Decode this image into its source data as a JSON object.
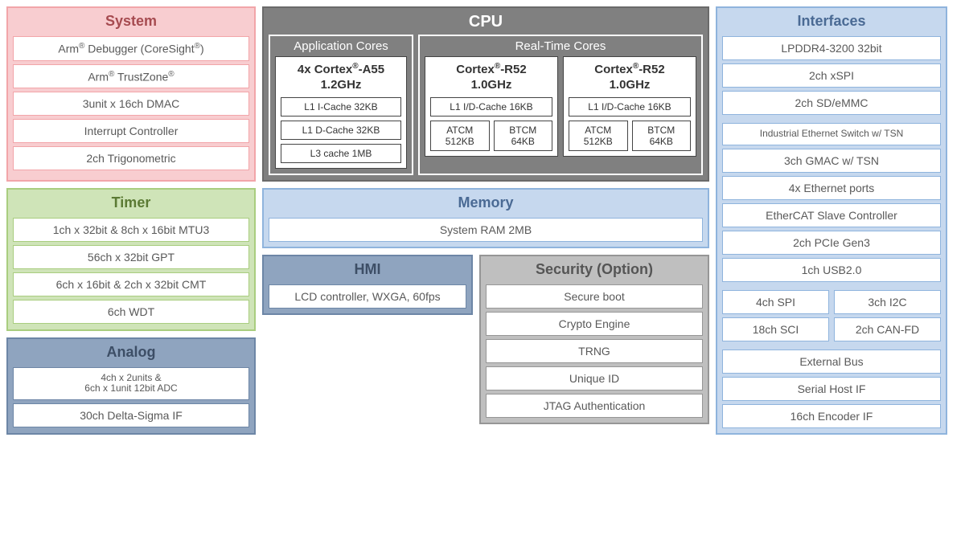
{
  "system": {
    "title": "System",
    "items": [
      "Arm® Debugger (CoreSight®)",
      "Arm® TrustZone®",
      "3unit x 16ch DMAC",
      "Interrupt Controller",
      "2ch Trigonometric"
    ]
  },
  "timer": {
    "title": "Timer",
    "items": [
      "1ch x 32bit & 8ch x 16bit MTU3",
      "56ch x 32bit GPT",
      "6ch x 16bit & 2ch x 32bit CMT",
      "6ch WDT"
    ]
  },
  "analog": {
    "title": "Analog",
    "adc_line1": "4ch x 2units &",
    "adc_line2": "6ch x 1unit 12bit ADC",
    "items": [
      "30ch Delta-Sigma IF"
    ]
  },
  "cpu": {
    "title": "CPU",
    "app_group": "Application Cores",
    "rt_group": "Real-Time Cores",
    "app_core": {
      "name": "4x Cortex®-A55",
      "freq": "1.2GHz",
      "l1i": "L1 I-Cache 32KB",
      "l1d": "L1 D-Cache 32KB",
      "l3": "L3 cache 1MB"
    },
    "rt_core": {
      "name": "Cortex®-R52",
      "freq": "1.0GHz",
      "l1": "L1 I/D-Cache 16KB",
      "atcm": "ATCM 512KB",
      "btcm": "BTCM 64KB"
    }
  },
  "memory": {
    "title": "Memory",
    "items": [
      "System RAM 2MB"
    ]
  },
  "hmi": {
    "title": "HMI",
    "items": [
      "LCD controller, WXGA, 60fps"
    ]
  },
  "security": {
    "title": "Security (Option)",
    "items": [
      "Secure boot",
      "Crypto Engine",
      "TRNG",
      "Unique ID",
      "JTAG Authentication"
    ]
  },
  "interfaces": {
    "title": "Interfaces",
    "top": [
      "LPDDR4-3200 32bit",
      "2ch xSPI",
      "2ch SD/eMMC"
    ],
    "net": [
      "Industrial Ethernet Switch w/ TSN",
      "3ch GMAC w/ TSN",
      "4x Ethernet ports",
      "EtherCAT Slave Controller",
      "2ch PCIe Gen3",
      "1ch USB2.0"
    ],
    "row1a": "4ch SPI",
    "row1b": "3ch I2C",
    "row2a": "18ch SCI",
    "row2b": "2ch CAN-FD",
    "bottom": [
      "External Bus",
      "Serial Host IF",
      "16ch Encoder IF"
    ]
  }
}
